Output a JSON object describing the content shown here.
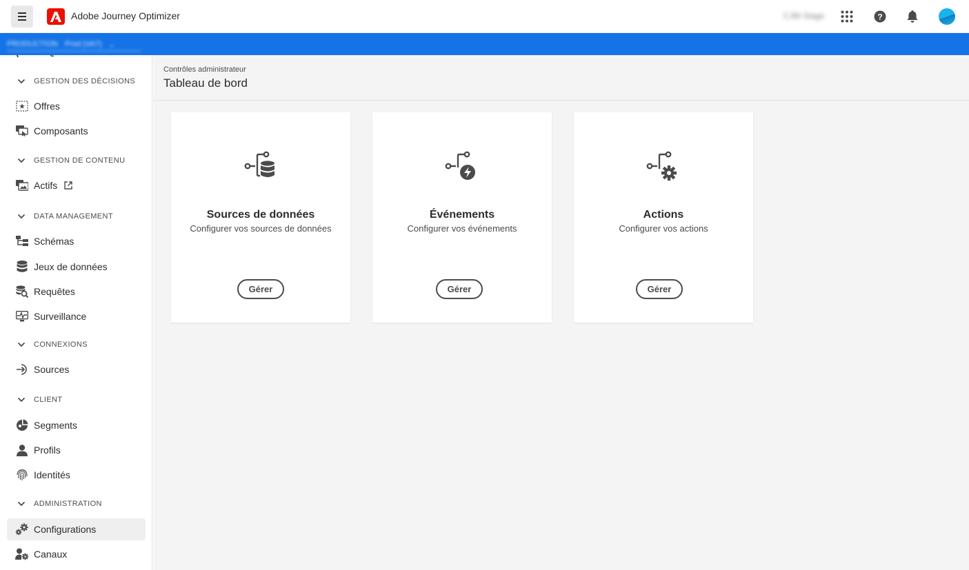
{
  "app": {
    "title": "Adobe Journey Optimizer",
    "org_name": "CJM Stage"
  },
  "org_bar": {
    "org_label": "PRODUCTION",
    "sandbox_label": "Prod (VA7)"
  },
  "sidebar": {
    "sections": [
      {
        "label": "GESTION DES DÉCISIONS"
      },
      {
        "label": "GESTION DE CONTENU"
      },
      {
        "label": "DATA MANAGEMENT"
      },
      {
        "label": "CONNEXIONS"
      },
      {
        "label": "CLIENT"
      },
      {
        "label": "ADMINISTRATION"
      }
    ],
    "items": [
      {
        "label": "Offres",
        "icon": "offers-icon"
      },
      {
        "label": "Composants",
        "icon": "components-icon"
      },
      {
        "label": "Actifs",
        "icon": "assets-icon"
      },
      {
        "label": "Schémas",
        "icon": "schema-icon"
      },
      {
        "label": "Jeux de données",
        "icon": "datasets-icon"
      },
      {
        "label": "Requêtes",
        "icon": "queries-icon"
      },
      {
        "label": "Surveillance",
        "icon": "monitoring-icon"
      },
      {
        "label": "Sources",
        "icon": "sources-icon"
      },
      {
        "label": "Segments",
        "icon": "segments-icon"
      },
      {
        "label": "Profils",
        "icon": "profiles-icon"
      },
      {
        "label": "Identités",
        "icon": "identities-icon"
      },
      {
        "label": "Configurations",
        "icon": "configurations-icon",
        "active": true
      },
      {
        "label": "Canaux",
        "icon": "channels-icon"
      }
    ]
  },
  "main": {
    "breadcrumb": "Contrôles administrateur",
    "title": "Tableau de bord",
    "cards": [
      {
        "title": "Sources de données",
        "subtitle": "Configurer vos sources de données",
        "button": "Gérer",
        "icon": "data-sources-icon"
      },
      {
        "title": "Événements",
        "subtitle": "Configurer vos événements",
        "button": "Gérer",
        "icon": "events-icon"
      },
      {
        "title": "Actions",
        "subtitle": "Configurer vos actions",
        "button": "Gérer",
        "icon": "actions-icon"
      }
    ]
  },
  "colors": {
    "brand": "#eb1000",
    "accent": "#1473e6",
    "sidebar_active": "#efefef",
    "main_bg": "#f4f4f4"
  }
}
